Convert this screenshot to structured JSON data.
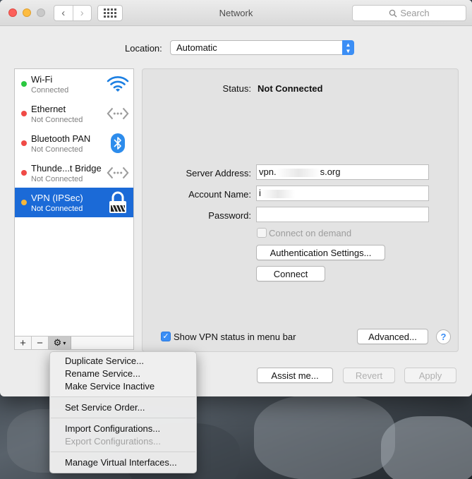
{
  "window": {
    "title": "Network",
    "search_placeholder": "Search"
  },
  "location": {
    "label": "Location:",
    "value": "Automatic"
  },
  "services": [
    {
      "name": "Wi-Fi",
      "status": "Connected",
      "dot_color": "#2bc840",
      "icon": "wifi-icon"
    },
    {
      "name": "Ethernet",
      "status": "Not Connected",
      "dot_color": "#f04a46",
      "icon": "ethernet-icon"
    },
    {
      "name": "Bluetooth PAN",
      "status": "Not Connected",
      "dot_color": "#f04a46",
      "icon": "bluetooth-icon"
    },
    {
      "name": "Thunde...t Bridge",
      "status": "Not Connected",
      "dot_color": "#f04a46",
      "icon": "thunderbolt-bridge-icon"
    },
    {
      "name": "VPN (IPSec)",
      "status": "Not Connected",
      "dot_color": "#f7b73a",
      "icon": "lock-icon",
      "selected": true
    }
  ],
  "sidebar_controls": {
    "add": "+",
    "remove": "−",
    "gear": "⚙"
  },
  "detail": {
    "status_label": "Status:",
    "status_value": "Not Connected",
    "server_address_label": "Server Address:",
    "server_address_value_start": "vpn.",
    "server_address_value_end": "s.org",
    "account_name_label": "Account Name:",
    "account_name_value": "i",
    "password_label": "Password:",
    "password_value": "",
    "connect_on_demand_label": "Connect on demand",
    "auth_settings_button": "Authentication Settings...",
    "connect_button": "Connect",
    "show_vpn_status_label": "Show VPN status in menu bar",
    "advanced_button": "Advanced...",
    "help_button": "?"
  },
  "footer": {
    "assist_button": "Assist me...",
    "revert_button": "Revert",
    "apply_button": "Apply"
  },
  "gear_menu": {
    "items": [
      {
        "label": "Duplicate Service...",
        "enabled": true
      },
      {
        "label": "Rename Service...",
        "enabled": true
      },
      {
        "label": "Make Service Inactive",
        "enabled": true
      },
      {
        "label": "Set Service Order...",
        "enabled": true
      },
      {
        "label": "Import Configurations...",
        "enabled": true
      },
      {
        "label": "Export Configurations...",
        "enabled": false
      },
      {
        "label": "Manage Virtual Interfaces...",
        "enabled": true
      }
    ]
  },
  "colors": {
    "selection": "#1b6ad7",
    "accent": "#3b8ef5"
  }
}
